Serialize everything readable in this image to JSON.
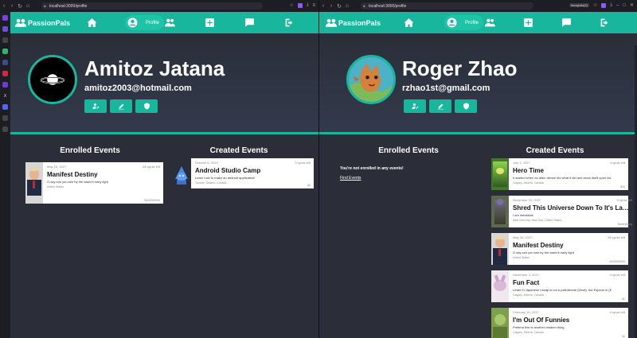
{
  "left": {
    "browser": {
      "url": "localhost:3000/profile"
    },
    "nav": {
      "brand": "PassionPals",
      "profile_label": "Profile"
    },
    "profile": {
      "name": "Amitoz Jatana",
      "email": "amitoz2003@hotmail.com"
    },
    "enrolled": {
      "title": "Enrolled Events",
      "events": [
        {
          "date": "May 26, 2027",
          "spots": "66 spots left",
          "title": "Manifest Destiny",
          "desc": "O say can you see by the dawn's early light",
          "location": "United States",
          "price": "$100000000"
        }
      ]
    },
    "created": {
      "title": "Created Events",
      "events": [
        {
          "date": "October 8, 2023",
          "spots": "2 spots left",
          "title": "Android Studio Camp",
          "desc": "Learn how to make an android application!",
          "location": "Toronto, Ontario, Canada",
          "price": "$0"
        }
      ]
    }
  },
  "right": {
    "browser": {
      "url": "localhost:3000/profile",
      "badge": "Incognito(2)"
    },
    "nav": {
      "brand": "PassionPals",
      "profile_label": "Profile"
    },
    "profile": {
      "name": "Roger Zhao",
      "email": "rzhao1st@gmail.com"
    },
    "enrolled": {
      "title": "Enrolled Events",
      "empty": "You're not enrolled in any events!",
      "find": "Find Events"
    },
    "created": {
      "title": "Created Events",
      "events": [
        {
          "date": "July 1, 2027",
          "spots": "4 spots left",
          "title": "Hero Time",
          "desc": "It started when an alien device did what it did and stuck itself upon his",
          "location": "Calgary, Alberta, Canada",
          "price": "$10"
        },
        {
          "date": "November 24, 2027",
          "spots": "9 spots left",
          "title": "Shred This Universe Down To It's Last Ato",
          "desc": "I am inevitable",
          "location": "New York City, New York, United States",
          "price": "$everything"
        },
        {
          "date": "May 26, 2027",
          "spots": "66 spots left",
          "title": "Manifest Destiny",
          "desc": "O say can you see by the dawn's early light",
          "location": "United States",
          "price": "$100000000"
        },
        {
          "date": "December 3, 2027",
          "spots": "4 spots left",
          "title": "Fun Fact",
          "desc": "Lewie in Japanese romaji is not a palindrome (Ûewi), but Espeon is (E",
          "location": "Calgary, Alberta, Canada",
          "price": "$2"
        },
        {
          "date": "February 16, 2027",
          "spots": "4 spots left",
          "title": "I'm Out Of Funnies",
          "desc": "Pretend this is another random thing",
          "location": "Calgary, Alberta, Canada",
          "price": "$4"
        }
      ]
    }
  },
  "colors": {
    "accent": "#17b69d",
    "bg": "#2b2e38"
  }
}
